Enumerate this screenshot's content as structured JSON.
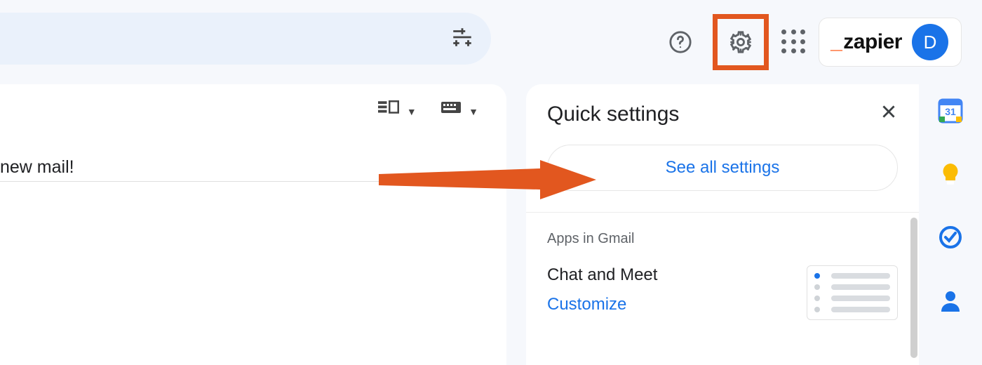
{
  "search": {
    "placeholder": ""
  },
  "brand": {
    "name": "zapier",
    "avatar_letter": "D"
  },
  "mail": {
    "preview_line": "new mail!"
  },
  "settings_panel": {
    "title": "Quick settings",
    "see_all": "See all settings",
    "section_label": "Apps in Gmail",
    "chat_label": "Chat and Meet",
    "customize": "Customize"
  },
  "side_apps": {
    "calendar_day": "31"
  },
  "colors": {
    "highlight": "#e2571f",
    "link": "#1a73e8"
  }
}
